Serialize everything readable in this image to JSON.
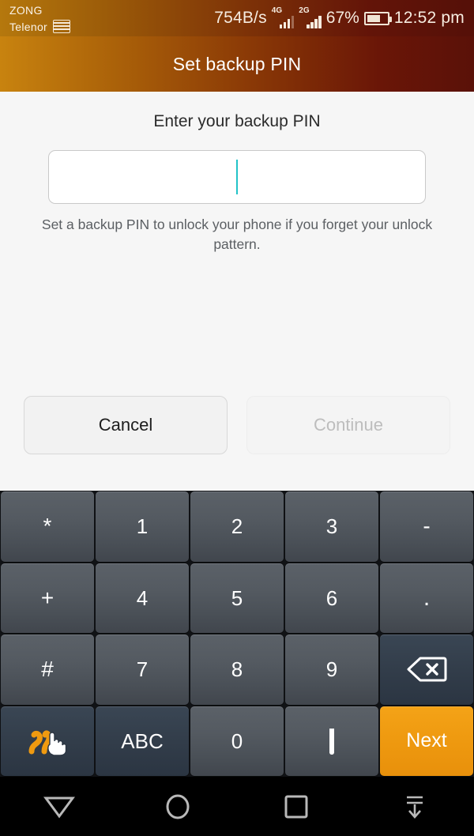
{
  "statusbar": {
    "carrier_line1": "ZONG",
    "carrier_line2": "Telenor",
    "sim_icon": "sim-card-icon",
    "network_speed": "754B/s",
    "signal1_label": "4G",
    "signal2_label": "2G",
    "battery_percent": "67%",
    "battery_level": 67,
    "battery_icon": "battery-icon",
    "clock": "12:52 pm"
  },
  "titlebar": {
    "title": "Set backup PIN",
    "gradient_from": "#c8830f",
    "gradient_to": "#5a1108"
  },
  "content": {
    "prompt": "Enter your backup PIN",
    "pin_value": "",
    "pin_placeholder": "",
    "caret_color": "#22c3c8",
    "description": "Set a backup PIN to unlock your phone if you forget your unlock pattern.",
    "cancel_label": "Cancel",
    "continue_label": "Continue",
    "continue_enabled": false
  },
  "keyboard": {
    "accent_color": "#ef9a10",
    "rows": [
      [
        {
          "label": "*",
          "name": "key-asterisk",
          "style": "sym"
        },
        {
          "label": "1",
          "name": "key-1",
          "style": "num"
        },
        {
          "label": "2",
          "name": "key-2",
          "style": "num"
        },
        {
          "label": "3",
          "name": "key-3",
          "style": "num"
        },
        {
          "label": "-",
          "name": "key-hyphen",
          "style": "sym"
        }
      ],
      [
        {
          "label": "+",
          "name": "key-plus",
          "style": "sym"
        },
        {
          "label": "4",
          "name": "key-4",
          "style": "num"
        },
        {
          "label": "5",
          "name": "key-5",
          "style": "num"
        },
        {
          "label": "6",
          "name": "key-6",
          "style": "num"
        },
        {
          "label": ".",
          "name": "key-period",
          "style": "period"
        }
      ],
      [
        {
          "label": "#",
          "name": "key-hash",
          "style": "sym"
        },
        {
          "label": "7",
          "name": "key-7",
          "style": "num"
        },
        {
          "label": "8",
          "name": "key-8",
          "style": "num"
        },
        {
          "label": "9",
          "name": "key-9",
          "style": "num"
        },
        {
          "label": "",
          "name": "key-backspace",
          "style": "dark",
          "icon": "backspace-icon"
        }
      ],
      [
        {
          "label": "",
          "name": "key-handwriting",
          "style": "dark",
          "icon": "handwriting-icon"
        },
        {
          "label": "ABC",
          "name": "key-abc",
          "style": "dark"
        },
        {
          "label": "0",
          "name": "key-0",
          "style": "num"
        },
        {
          "label": "",
          "name": "key-space",
          "style": "num",
          "icon": "space-icon"
        },
        {
          "label": "Next",
          "name": "key-next",
          "style": "orange"
        }
      ]
    ]
  },
  "navbar": {
    "items": [
      {
        "name": "nav-back-button",
        "icon": "triangle-down-icon"
      },
      {
        "name": "nav-home-button",
        "icon": "circle-icon"
      },
      {
        "name": "nav-recents-button",
        "icon": "square-icon"
      },
      {
        "name": "nav-hide-keyboard-button",
        "icon": "hide-keyboard-icon"
      }
    ]
  }
}
